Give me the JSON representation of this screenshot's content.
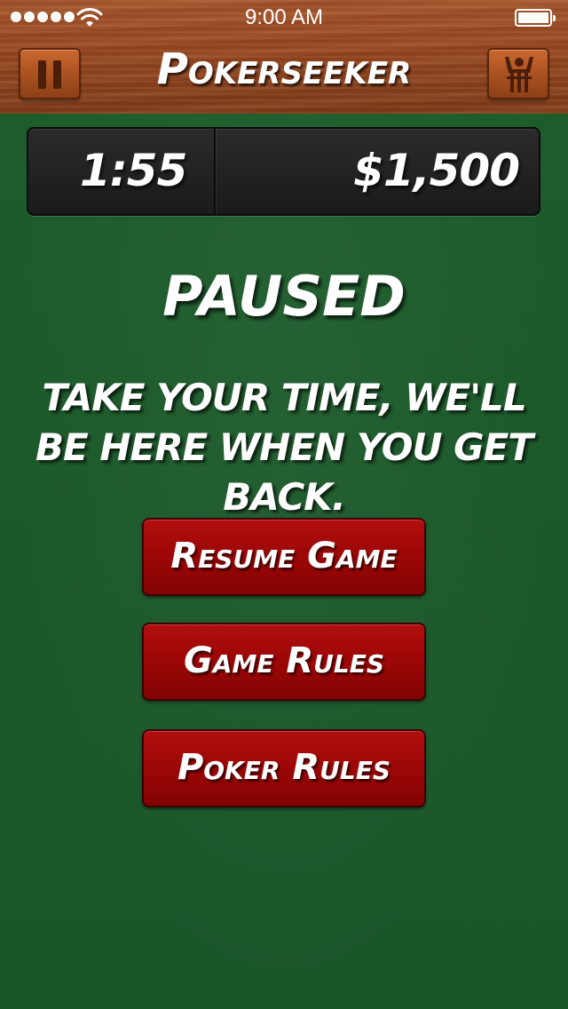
{
  "status_bar": {
    "time": "9:00 AM",
    "signal_icon": "signal-dots-icon",
    "wifi_icon": "wifi-icon",
    "battery_icon": "battery-icon"
  },
  "nav": {
    "title": "Pokerseeker",
    "left_button_icon": "pause-icon",
    "right_button_icon": "leaderboard-icon"
  },
  "scoreboard": {
    "timer": "1:55",
    "money": "$1,500"
  },
  "paused": {
    "heading": "PAUSED",
    "message": "Take your time, we'll be here when you get back."
  },
  "menu": {
    "resume_label": "Resume Game",
    "game_rules_label": "Game Rules",
    "poker_rules_label": "Poker Rules"
  },
  "colors": {
    "felt": "#1c5a2a",
    "wood": "#93461f",
    "button_red": "#9a0606",
    "scoreboard": "#222222"
  }
}
